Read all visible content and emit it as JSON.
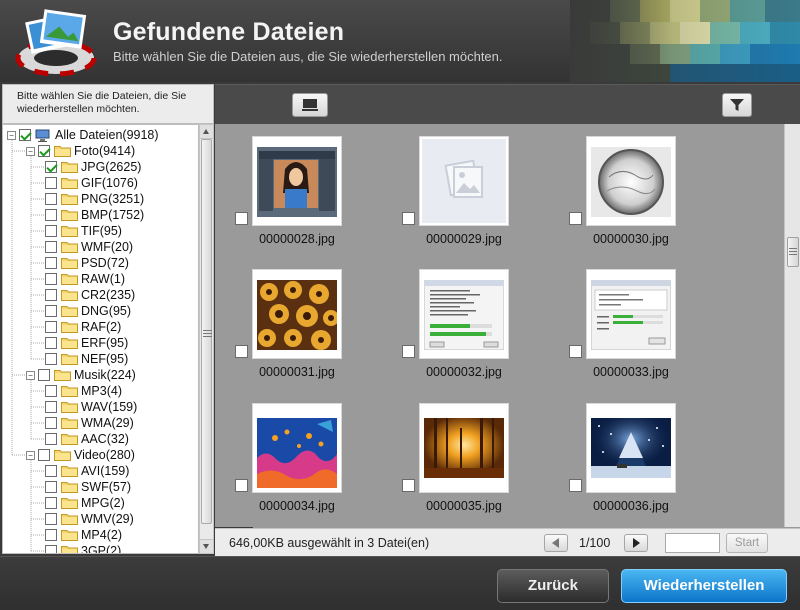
{
  "header": {
    "title": "Gefundene Dateien",
    "subtitle": "Bitte wählen Sie die Dateien aus, die Sie wiederherstellen möchten."
  },
  "left_hint": {
    "line1": "Bitte wählen Sie die Dateien, die Sie",
    "line2": "wiederherstellen möchten."
  },
  "tree": {
    "root": {
      "label": "Alle Dateien(9918)",
      "checked": true
    },
    "groups": [
      {
        "label": "Foto(9414)",
        "checked": true,
        "items": [
          {
            "label": "JPG(2625)",
            "checked": true
          },
          {
            "label": "GIF(1076)",
            "checked": false
          },
          {
            "label": "PNG(3251)",
            "checked": false
          },
          {
            "label": "BMP(1752)",
            "checked": false
          },
          {
            "label": "TIF(95)",
            "checked": false
          },
          {
            "label": "WMF(20)",
            "checked": false
          },
          {
            "label": "PSD(72)",
            "checked": false
          },
          {
            "label": "RAW(1)",
            "checked": false
          },
          {
            "label": "CR2(235)",
            "checked": false
          },
          {
            "label": "DNG(95)",
            "checked": false
          },
          {
            "label": "RAF(2)",
            "checked": false
          },
          {
            "label": "ERF(95)",
            "checked": false
          },
          {
            "label": "NEF(95)",
            "checked": false
          }
        ]
      },
      {
        "label": "Musik(224)",
        "checked": false,
        "items": [
          {
            "label": "MP3(4)",
            "checked": false
          },
          {
            "label": "WAV(159)",
            "checked": false
          },
          {
            "label": "WMA(29)",
            "checked": false
          },
          {
            "label": "AAC(32)",
            "checked": false
          }
        ]
      },
      {
        "label": "Video(280)",
        "checked": false,
        "items": [
          {
            "label": "AVI(159)",
            "checked": false
          },
          {
            "label": "SWF(57)",
            "checked": false
          },
          {
            "label": "MPG(2)",
            "checked": false
          },
          {
            "label": "WMV(29)",
            "checked": false
          },
          {
            "label": "MP4(2)",
            "checked": false
          },
          {
            "label": "3GP(2)",
            "checked": false
          }
        ]
      }
    ]
  },
  "files": [
    {
      "name": "00000028.jpg",
      "thumb": "screenshot-portrait"
    },
    {
      "name": "00000029.jpg",
      "thumb": "placeholder-image-icon"
    },
    {
      "name": "00000030.jpg",
      "thumb": "gray-sphere"
    },
    {
      "name": "00000031.jpg",
      "thumb": "flower-pattern"
    },
    {
      "name": "00000032.jpg",
      "thumb": "dialog-screenshot"
    },
    {
      "name": "00000033.jpg",
      "thumb": "progress-dialog"
    },
    {
      "name": "00000034.jpg",
      "thumb": "coral-reef"
    },
    {
      "name": "00000035.jpg",
      "thumb": "golden-forest"
    },
    {
      "name": "00000036.jpg",
      "thumb": "snowy-night"
    }
  ],
  "status": {
    "selection": "646,00KB ausgewählt in 3 Datei(en)",
    "page": "1/100",
    "start_label": "Start"
  },
  "footer": {
    "back_label": "Zurück",
    "restore_label": "Wiederherstellen"
  },
  "colors": {
    "accent": "#1a8ee0",
    "check": "#1a9a1a",
    "grid_bg": "#9a9a9a"
  }
}
